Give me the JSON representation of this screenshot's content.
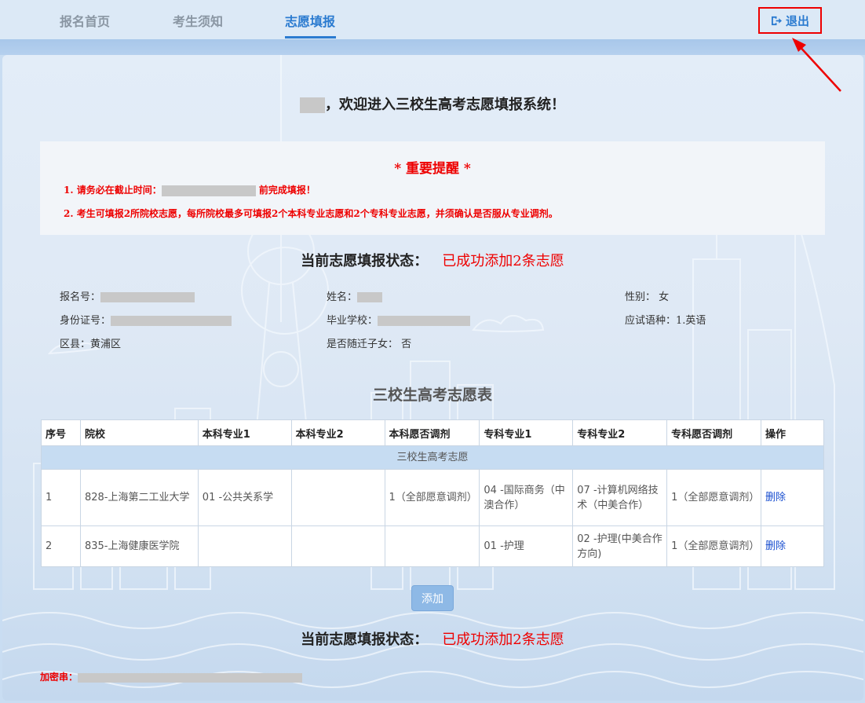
{
  "nav": {
    "items": [
      {
        "label": "报名首页"
      },
      {
        "label": "考生须知"
      },
      {
        "label": "志愿填报"
      }
    ],
    "active_index": 2,
    "logout_label": "退出",
    "logout_icon": "sign-out-icon"
  },
  "welcome": {
    "text": "，欢迎进入三校生高考志愿填报系统！"
  },
  "notice": {
    "title": "* 重要提醒 *",
    "line1_prefix": "1. 请务必在截止时间：",
    "line1_suffix": "前完成填报！",
    "line2": "2. 考生可填报2所院校志愿，每所院校最多可填报2个本科专业志愿和2个专科专业志愿，并须确认是否服从专业调剂。"
  },
  "status": {
    "label": "当前志愿填报状态：",
    "value": "已成功添加2条志愿"
  },
  "info": {
    "reg_no_label": "报名号：",
    "name_label": "姓名：",
    "gender_label": "性别：",
    "gender_value": "女",
    "id_label": "身份证号：",
    "school_label": "毕业学校：",
    "lang_label": "应试语种：",
    "lang_value": "1.英语",
    "district_label": "区县：",
    "district_value": "黄浦区",
    "migrant_label": "是否随迁子女：",
    "migrant_value": "否"
  },
  "table": {
    "title": "三校生高考志愿表",
    "headers": [
      "序号",
      "院校",
      "本科专业1",
      "本科专业2",
      "本科愿否调剂",
      "专科专业1",
      "专科专业2",
      "专科愿否调剂",
      "操作"
    ],
    "group_label": "三校生高考志愿",
    "rows": [
      [
        "1",
        "828-上海第二工业大学",
        "01 -公共关系学",
        "",
        "1（全部愿意调剂）",
        "04 -国际商务（中澳合作）",
        "07 -计算机网络技术（中美合作）",
        "1（全部愿意调剂）",
        "删除"
      ],
      [
        "2",
        "835-上海健康医学院",
        "",
        "",
        "",
        "01 -护理",
        "02 -护理(中美合作方向)",
        "1（全部愿意调剂）",
        "删除"
      ]
    ]
  },
  "add_button": "添加",
  "encrypt_label": "加密串：",
  "colors": {
    "accent": "#2b7bd0",
    "alert": "#ee0000",
    "header_group_bg": "#c6dcf2"
  }
}
